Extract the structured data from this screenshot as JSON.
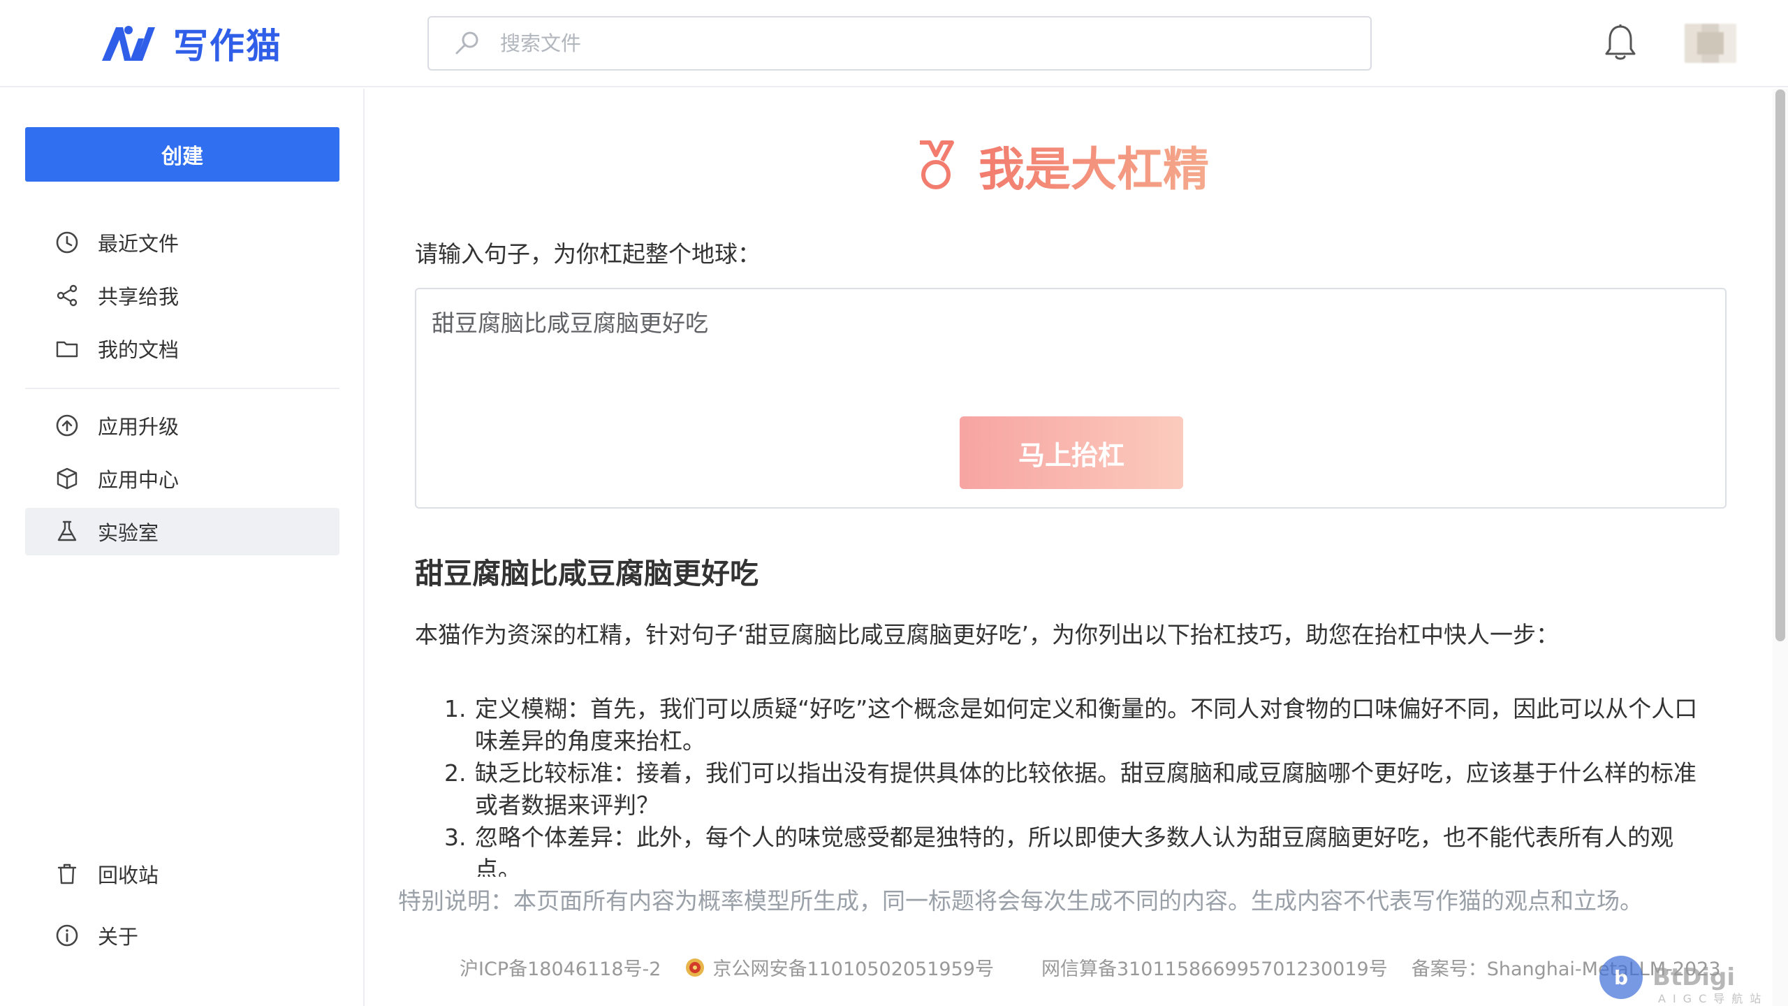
{
  "header": {
    "brand": "写作猫",
    "search_placeholder": "搜索文件"
  },
  "sidebar": {
    "create_label": "创建",
    "items": [
      {
        "label": "最近文件",
        "icon": "clock-icon"
      },
      {
        "label": "共享给我",
        "icon": "share-icon"
      },
      {
        "label": "我的文档",
        "icon": "folder-icon"
      },
      {
        "label": "应用升级",
        "icon": "upgrade-icon"
      },
      {
        "label": "应用中心",
        "icon": "box-icon"
      },
      {
        "label": "实验室",
        "icon": "flask-icon",
        "active": true
      },
      {
        "label": "回收站",
        "icon": "trash-icon"
      },
      {
        "label": "关于",
        "icon": "info-icon"
      }
    ]
  },
  "main": {
    "title": "我是大杠精",
    "prompt_label": "请输入句子，为你杠起整个地球：",
    "input_value": "甜豆腐脑比咸豆腐脑更好吃",
    "submit_label": "马上抬杠",
    "result_title": "甜豆腐脑比咸豆腐脑更好吃",
    "result_intro": "本猫作为资深的杠精，针对句子‘甜豆腐脑比咸豆腐脑更好吃’，为你列出以下抬杠技巧，助您在抬杠中快人一步：",
    "points": [
      {
        "num": "1.",
        "text": "定义模糊：首先，我们可以质疑“好吃”这个概念是如何定义和衡量的。不同人对食物的口味偏好不同，因此可以从个人口味差异的角度来抬杠。"
      },
      {
        "num": "2.",
        "text": "缺乏比较标准：接着，我们可以指出没有提供具体的比较依据。甜豆腐脑和咸豆腐脑哪个更好吃，应该基于什么样的标准或者数据来评判？"
      },
      {
        "num": "3.",
        "text": "忽略个体差异：此外，每个人的味觉感受都是独特的，所以即使大多数人认为甜豆腐脑更好吃，也不能代表所有人的观点。"
      }
    ],
    "disclaimer": "特别说明：本页面所有内容为概率模型所生成，同一标题将会每次生成不同的内容。生成内容不代表写作猫的观点和立场。"
  },
  "footer": {
    "icp": "沪ICP备18046118号-2",
    "police": "京公网安备11010502051959号",
    "algo": "网信算备310115866995701230019号",
    "record": "备案号：Shanghai-MetaLLM-2023"
  },
  "watermark": {
    "logo_text": "b",
    "text": "BtDigi",
    "sub": "AIGC导航站"
  },
  "colors": {
    "brand_blue": "#2f6ff0",
    "hero_gradient_start": "#f27c6e",
    "hero_gradient_end": "#f5a98c"
  }
}
